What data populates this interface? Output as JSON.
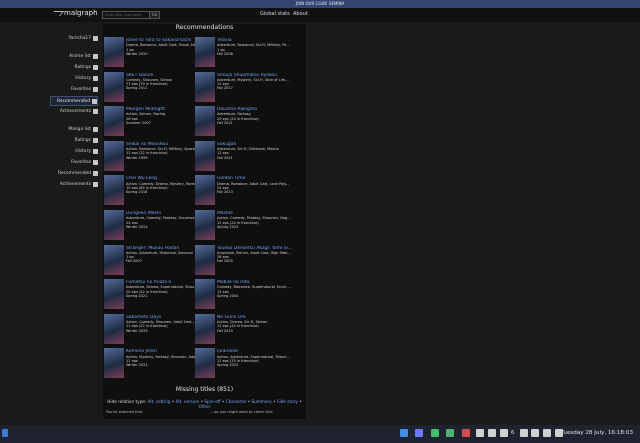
{
  "banner": {
    "text": "JOIN OUR CLUB! SEMINA"
  },
  "nav": {
    "logo_text": "malgraph",
    "search_placeholder": "Enter MAL username",
    "search_button": "Go",
    "links": [
      "Global stats",
      "About"
    ]
  },
  "sidebar": {
    "user": "Yamcha17",
    "anime_items": [
      "Anime list",
      "Ratings",
      "History",
      "Favorites",
      "Recommended",
      "Achievements"
    ],
    "manga_items": [
      "Manga list",
      "Ratings",
      "History",
      "Favorites",
      "Recommended",
      "Achievements"
    ]
  },
  "main": {
    "title": "Recommendations",
    "cards": [
      {
        "name": "Josee to Tora to Sakana-tachi",
        "meta": [
          "Drama, Romance, Adult Cast, Visual Arts",
          "1 ep",
          "Winter 2020"
        ]
      },
      {
        "name": "Telaria",
        "meta": [
          "Adventure, Romance, Sci-Fi, Military, Ps...",
          "1 ep",
          "Fall 2008"
        ]
      },
      {
        "name": "SKET Dance",
        "meta": [
          "Comedy, Shounen, School",
          "77 eps (79 in franchise)",
          "Spring 2011"
        ]
      },
      {
        "name": "Shoujo Shuumatsu Ryokou",
        "meta": [
          "Adventure, Mystery, Sci-Fi, Slice of Life,...",
          "12 eps",
          "Fall 2017"
        ]
      },
      {
        "name": "Mangen Midnight",
        "meta": [
          "Action, Seinen, Racing",
          "26 eps",
          "Summer 2007"
        ]
      },
      {
        "name": "Douama Rakigma",
        "meta": [
          "Adventure, Fantasy",
          "20 eps (20 in franchise)",
          "Fall 2021"
        ]
      },
      {
        "name": "Seikai no Monshou",
        "meta": [
          "Action, Romance, Sci-Fi, Military, Space",
          "13 eps (32 in franchise)",
          "Winter 1999"
        ]
      },
      {
        "name": "Sakugan",
        "meta": [
          "Adventure, Sci-Fi, Childcare, Mecha",
          "12 eps",
          "Fall 2021"
        ]
      },
      {
        "name": "Chei Wu Looq",
        "meta": [
          "Action, Comedy, Drama, Mystery, Roma...",
          "10 eps (84 in franchise)",
          "Spring 2018"
        ]
      },
      {
        "name": "Golden Time",
        "meta": [
          "Drama, Romance, Adult Cast, Love Poly...",
          "24 eps",
          "Fall 2013"
        ]
      },
      {
        "name": "Dungeon Meshi",
        "meta": [
          "Adventure, Comedy, Fantasy, Gourmet,...",
          "24 eps",
          "Winter 2024"
        ]
      },
      {
        "name": "Mashle",
        "meta": [
          "Action, Comedy, Fantasy, Shounen, Gag...",
          "12 eps (24 in franchise)",
          "Spring 2023"
        ]
      },
      {
        "name": "Stranger: Mukou Hadan",
        "meta": [
          "Action, Adventure, Historical, Samurai",
          "1 ep",
          "Fall 2007"
        ]
      },
      {
        "name": "Tsuihai Densetsu Akagi: Yami ni...",
        "meta": [
          "Suspense, Seinen, Adult Cast, High Stak...",
          "26 eps",
          "Fall 2005"
        ]
      },
      {
        "name": "Fumetsu no Anata e",
        "meta": [
          "Adventure, Drama, Supernatural, Shou...",
          "20 eps (42 in franchise)",
          "Spring 2021"
        ]
      },
      {
        "name": "Mobile no Hito",
        "meta": [
          "Comedy, Romance, Supernatural, Ecchi,...",
          "12 eps",
          "Spring 2004"
        ]
      },
      {
        "name": "Sakamoto Days",
        "meta": [
          "Action, Comedy, Shounen, Adult Cast,...",
          "11 eps (22 in franchise)",
          "Winter 2025"
        ]
      },
      {
        "name": "No Guns Life",
        "meta": [
          "Action, Drama, Sci-Fi, Seinen",
          "12 eps (24 in franchise)",
          "Fall 2019"
        ]
      },
      {
        "name": "Kemono Jihen",
        "meta": [
          "Action, Mystery, Fantasy, Shounen, Ada...",
          "12 eps",
          "Winter 2021"
        ]
      },
      {
        "name": "Ijiranaide",
        "meta": [
          "Action, Adventure, Supernatural, Shoun...",
          "12 eps (25 in franchise)",
          "Spring 2023"
        ]
      }
    ]
  },
  "missing": {
    "title": "Missing titles (851)",
    "hide_label": "Hide relation type:",
    "options": [
      "Alt. setting",
      "Alt. version",
      "Spin-off",
      "Character",
      "Summary",
      "Side story",
      "Other"
    ],
    "left_col": "You've watched this:",
    "right_col": "...so you might want to check this:"
  },
  "taskbar": {
    "clock": "Tuesday 28 July, 16:18:03",
    "badge": "6"
  }
}
